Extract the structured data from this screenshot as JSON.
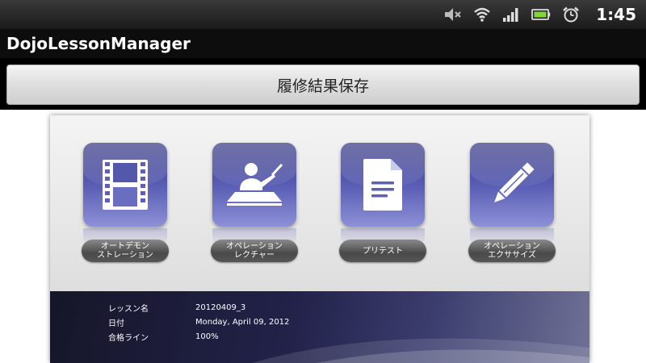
{
  "status_bar": {
    "icons": [
      "mute-icon",
      "wifi-icon",
      "signal-icon",
      "battery-icon",
      "alarm-icon"
    ],
    "time": "1:45"
  },
  "app": {
    "title": "DojoLessonManager"
  },
  "save_button": {
    "label": "履修結果保存"
  },
  "modes": [
    {
      "icon": "film-icon",
      "line1": "オートデモン",
      "line2": "ストレーション"
    },
    {
      "icon": "lecture-icon",
      "line1": "オペレーション",
      "line2": "レクチャー"
    },
    {
      "icon": "document-icon",
      "line1": "プリテスト",
      "line2": ""
    },
    {
      "icon": "pencil-icon",
      "line1": "オペレーション",
      "line2": "エクササイズ"
    }
  ],
  "lesson_info": [
    {
      "label": "レッスン名",
      "value": "20120409_3"
    },
    {
      "label": "日付",
      "value": "Monday, April 09, 2012"
    },
    {
      "label": "合格ライン",
      "value": "100%"
    }
  ],
  "colors": {
    "tile_top": "#3f4188",
    "tile_bottom": "#8d90d6",
    "panel_dark": "#161629"
  }
}
